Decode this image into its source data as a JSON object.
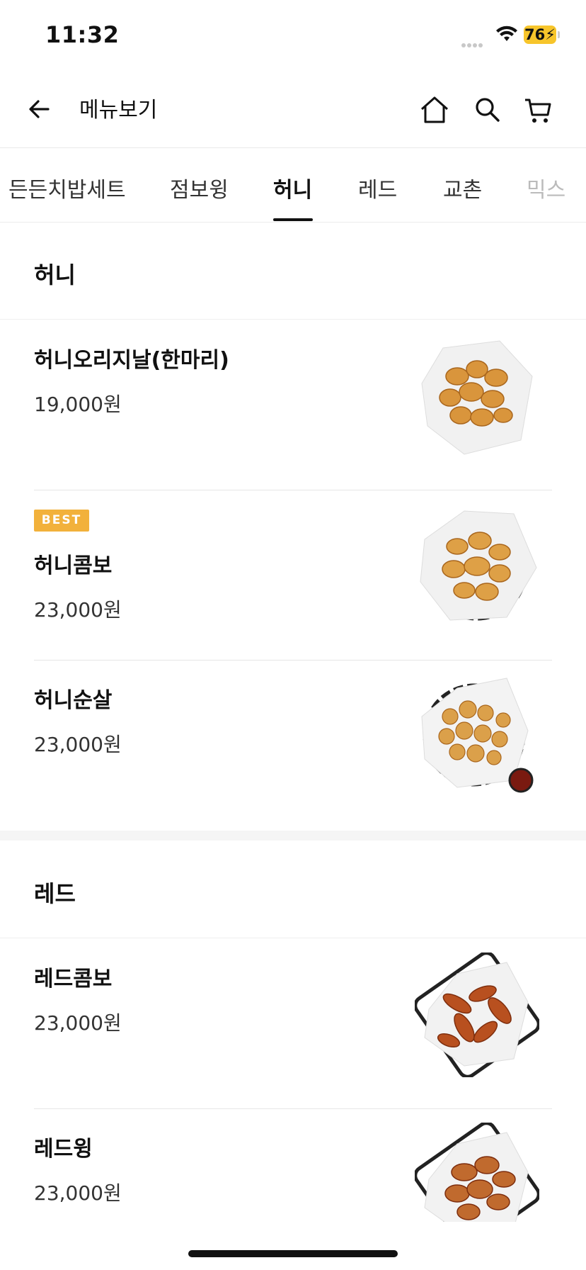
{
  "status_bar": {
    "time": "11:32",
    "battery": "76"
  },
  "header": {
    "title": "메뉴보기"
  },
  "tabs": [
    {
      "label": "든든치밥세트"
    },
    {
      "label": "점보윙"
    },
    {
      "label": "허니"
    },
    {
      "label": "레드"
    },
    {
      "label": "교촌"
    },
    {
      "label": "믹스"
    }
  ],
  "active_tab": "허니",
  "sections": [
    {
      "title": "허니",
      "items": [
        {
          "name": "허니오리지날(한마리)",
          "price": "19,000원",
          "badge": ""
        },
        {
          "name": "허니콤보",
          "price": "23,000원",
          "badge": "BEST"
        },
        {
          "name": "허니순살",
          "price": "23,000원",
          "badge": ""
        }
      ]
    },
    {
      "title": "레드",
      "items": [
        {
          "name": "레드콤보",
          "price": "23,000원",
          "badge": ""
        },
        {
          "name": "레드윙",
          "price": "23,000원",
          "badge": ""
        }
      ]
    }
  ],
  "colors": {
    "badge": "#f2b13b",
    "battery": "#f7c52b",
    "honey_chicken": "#d9953c",
    "red_chicken": "#b8501f"
  }
}
